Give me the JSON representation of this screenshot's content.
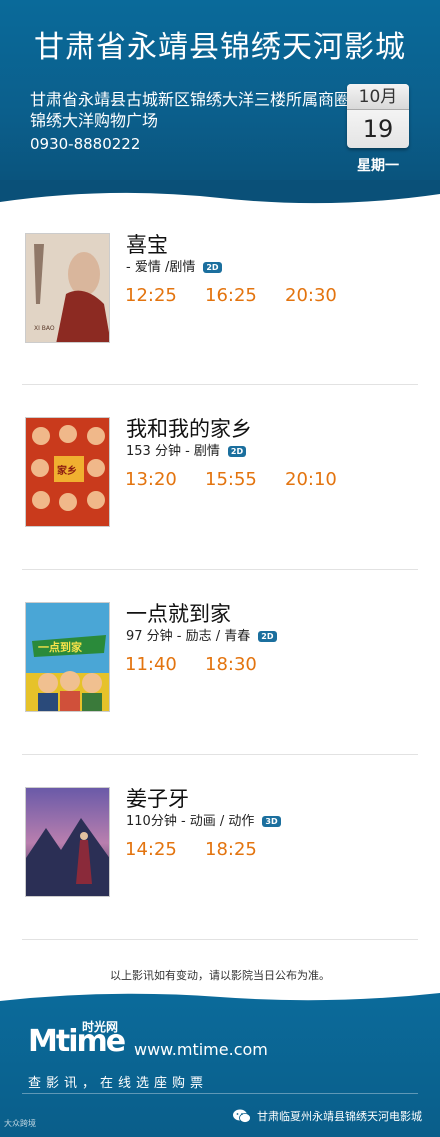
{
  "header": {
    "cinema_name": "甘肃省永靖县锦绣天河影城",
    "address": "甘肃省永靖县古城新区锦绣大洋三楼所属商圈锦绣大洋购物广场",
    "phone": "0930-8880222",
    "date": {
      "month": "10月",
      "day": "19",
      "weekday": "星期一"
    }
  },
  "movies": [
    {
      "title": "喜宝",
      "info": "- 爱情 /剧情",
      "format": "2D",
      "times": [
        "12:25",
        "16:25",
        "20:30"
      ],
      "poster_colors": [
        "#e9d9c9",
        "#8c2a22"
      ]
    },
    {
      "title": "我和我的家乡",
      "info": "153 分钟 - 剧情",
      "format": "2D",
      "times": [
        "13:20",
        "15:55",
        "20:10"
      ],
      "poster_colors": [
        "#c93a1c",
        "#f0b030"
      ]
    },
    {
      "title": "一点就到家",
      "info": "97 分钟 - 励志 / 青春",
      "format": "2D",
      "times": [
        "11:40",
        "18:30"
      ],
      "poster_colors": [
        "#4aa6d6",
        "#e6c22a"
      ]
    },
    {
      "title": "姜子牙",
      "info": "110分钟 - 动画 / 动作",
      "format": "3D",
      "times": [
        "14:25",
        "18:25"
      ],
      "poster_colors": [
        "#3a3b6e",
        "#b97fae"
      ]
    }
  ],
  "notice": "以上影讯如有变动，请以影院当日公布为准。",
  "footer": {
    "logo_brand": "Mtime",
    "logo_cn": "时光网",
    "url": "www.mtime.com",
    "slogan": "查影讯，在线选座购票",
    "wechat_account": "甘肃临夏州永靖县锦绣天河电影城",
    "watermark": "大众跨境"
  },
  "colors": {
    "header_blue": "#0b5f8c",
    "showtime_orange": "#e3740f"
  },
  "icons": [
    "calendar-card",
    "2d-badge",
    "3d-badge",
    "wechat-icon"
  ]
}
